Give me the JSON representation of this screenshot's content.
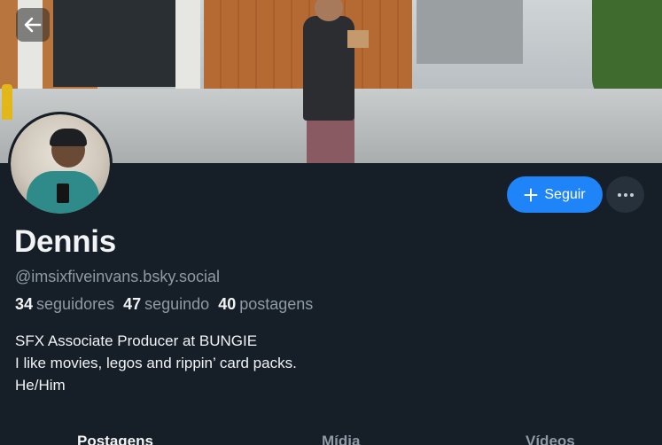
{
  "header": {
    "back_icon": "arrow-left-icon"
  },
  "profile": {
    "display_name": "Dennis",
    "handle": "@imsixfiveinvans.bsky.social",
    "stats": [
      {
        "count": "34",
        "label": "seguidores"
      },
      {
        "count": "47",
        "label": "seguindo"
      },
      {
        "count": "40",
        "label": "postagens"
      }
    ],
    "bio_lines": [
      "SFX Associate Producer at BUNGIE",
      "I like movies, legos and rippin’ card packs.",
      "He/Him"
    ]
  },
  "actions": {
    "follow_label": "Seguir",
    "follow_icon": "plus-icon",
    "more_icon": "ellipsis-icon"
  },
  "tabs": [
    {
      "label": "Postagens",
      "active": true
    },
    {
      "label": "Mídia",
      "active": false
    },
    {
      "label": "Vídeos",
      "active": false
    }
  ],
  "colors": {
    "background": "#161e27",
    "accent": "#1f84f7",
    "muted_text": "#8f9aa6"
  }
}
